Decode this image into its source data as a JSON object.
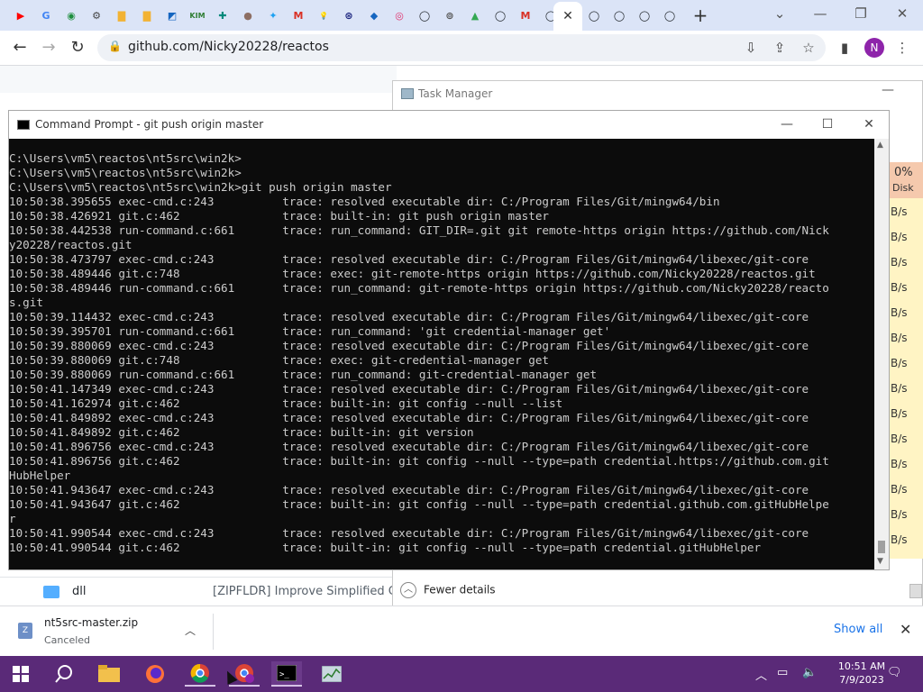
{
  "browser": {
    "tabs": [
      {
        "icon": "youtube-icon",
        "glyph": "▶",
        "color": "#ff0000"
      },
      {
        "icon": "google-icon",
        "glyph": "G",
        "color": "#4285f4"
      },
      {
        "icon": "green-circle-icon",
        "glyph": "◉",
        "color": "#1e8e3e"
      },
      {
        "icon": "gear-icon",
        "glyph": "⚙",
        "color": "#444444"
      },
      {
        "icon": "folder-icon",
        "glyph": "▇",
        "color": "#f2b233"
      },
      {
        "icon": "folder-icon",
        "glyph": "▇",
        "color": "#f2b233"
      },
      {
        "icon": "image-icon",
        "glyph": "◩",
        "color": "#1565c0"
      },
      {
        "icon": "kim-icon",
        "glyph": "KIM",
        "color": "#2e7d32"
      },
      {
        "icon": "puzzle-icon",
        "glyph": "✚",
        "color": "#00897b"
      },
      {
        "icon": "circle-icon",
        "glyph": "●",
        "color": "#8d6e63"
      },
      {
        "icon": "twitter-icon",
        "glyph": "✦",
        "color": "#1da1f2"
      },
      {
        "icon": "gmail-icon",
        "glyph": "M",
        "color": "#d93025"
      },
      {
        "icon": "bulb-icon",
        "glyph": "💡",
        "color": "#fbc02d"
      },
      {
        "icon": "globe-icon",
        "glyph": "⊛",
        "color": "#1a237e"
      },
      {
        "icon": "sonic-icon",
        "glyph": "◆",
        "color": "#1565c0"
      },
      {
        "icon": "instagram-icon",
        "glyph": "◎",
        "color": "#e1306c"
      },
      {
        "icon": "github-icon",
        "glyph": "◯",
        "color": "#24292f"
      },
      {
        "icon": "ring-icon",
        "glyph": "⊚",
        "color": "#555555"
      },
      {
        "icon": "drive-icon",
        "glyph": "▲",
        "color": "#34a853"
      },
      {
        "icon": "github-icon",
        "glyph": "◯",
        "color": "#24292f"
      },
      {
        "icon": "gmail-icon",
        "glyph": "M",
        "color": "#d93025"
      },
      {
        "icon": "github-icon",
        "glyph": "◯",
        "color": "#24292f"
      },
      {
        "icon": "github-icon",
        "glyph": "◯",
        "color": "#24292f"
      },
      {
        "icon": "github-icon",
        "glyph": "◯",
        "color": "#24292f"
      },
      {
        "icon": "github-icon",
        "glyph": "◯",
        "color": "#24292f"
      },
      {
        "icon": "github-icon",
        "glyph": "◯",
        "color": "#24292f"
      }
    ],
    "active_tab_close": "✕",
    "new_tab": "+",
    "url": "github.com/Nicky20228/reactos",
    "profile_initial": "N"
  },
  "page": {
    "file_name": "dll",
    "file_commit_message": "[ZIPFLDR] Improve Simplified Ch"
  },
  "task_manager": {
    "title": "Task Manager",
    "column_header_pct": "0%",
    "column_header_label": "Disk",
    "rows": [
      "B/s",
      "B/s",
      "B/s",
      "B/s",
      "B/s",
      "B/s",
      "B/s",
      "B/s",
      "B/s",
      "B/s",
      "B/s",
      "B/s",
      "B/s",
      "B/s"
    ],
    "fewer_details": "Fewer details"
  },
  "cmd": {
    "title": "Command Prompt - git  push origin master",
    "lines": [
      "C:\\Users\\vm5\\reactos\\nt5src\\win2k>",
      "C:\\Users\\vm5\\reactos\\nt5src\\win2k>",
      "C:\\Users\\vm5\\reactos\\nt5src\\win2k>git push origin master",
      "10:50:38.395655 exec-cmd.c:243          trace: resolved executable dir: C:/Program Files/Git/mingw64/bin",
      "10:50:38.426921 git.c:462               trace: built-in: git push origin master",
      "10:50:38.442538 run-command.c:661       trace: run_command: GIT_DIR=.git git remote-https origin https://github.com/Nick",
      "y20228/reactos.git",
      "10:50:38.473797 exec-cmd.c:243          trace: resolved executable dir: C:/Program Files/Git/mingw64/libexec/git-core",
      "10:50:38.489446 git.c:748               trace: exec: git-remote-https origin https://github.com/Nicky20228/reactos.git",
      "10:50:38.489446 run-command.c:661       trace: run_command: git-remote-https origin https://github.com/Nicky20228/reacto",
      "s.git",
      "10:50:39.114432 exec-cmd.c:243          trace: resolved executable dir: C:/Program Files/Git/mingw64/libexec/git-core",
      "10:50:39.395701 run-command.c:661       trace: run_command: 'git credential-manager get'",
      "10:50:39.880069 exec-cmd.c:243          trace: resolved executable dir: C:/Program Files/Git/mingw64/libexec/git-core",
      "10:50:39.880069 git.c:748               trace: exec: git-credential-manager get",
      "10:50:39.880069 run-command.c:661       trace: run_command: git-credential-manager get",
      "10:50:41.147349 exec-cmd.c:243          trace: resolved executable dir: C:/Program Files/Git/mingw64/libexec/git-core",
      "10:50:41.162974 git.c:462               trace: built-in: git config --null --list",
      "10:50:41.849892 exec-cmd.c:243          trace: resolved executable dir: C:/Program Files/Git/mingw64/libexec/git-core",
      "10:50:41.849892 git.c:462               trace: built-in: git version",
      "10:50:41.896756 exec-cmd.c:243          trace: resolved executable dir: C:/Program Files/Git/mingw64/libexec/git-core",
      "10:50:41.896756 git.c:462               trace: built-in: git config --null --type=path credential.https://github.com.git",
      "HubHelper",
      "10:50:41.943647 exec-cmd.c:243          trace: resolved executable dir: C:/Program Files/Git/mingw64/libexec/git-core",
      "10:50:41.943647 git.c:462               trace: built-in: git config --null --type=path credential.github.com.gitHubHelpe",
      "r",
      "10:50:41.990544 exec-cmd.c:243          trace: resolved executable dir: C:/Program Files/Git/mingw64/libexec/git-core",
      "10:50:41.990544 git.c:462               trace: built-in: git config --null --type=path credential.gitHubHelper"
    ]
  },
  "download": {
    "file": "nt5src-master.zip",
    "status": "Canceled",
    "show_all": "Show all"
  },
  "taskbar": {
    "time": "10:51 AM",
    "date": "7/9/2023"
  },
  "colors": {
    "taskbar": "#5a2a78",
    "tabstrip": "#dbe4f7",
    "console_bg": "#0c0c0c",
    "console_text": "#cccccc",
    "taskmgr_highlight": "#fff4c4"
  }
}
